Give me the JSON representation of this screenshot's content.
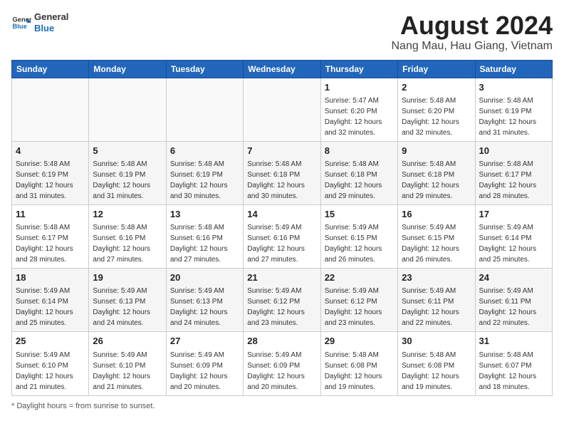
{
  "header": {
    "logo_line1": "General",
    "logo_line2": "Blue",
    "title": "August 2024",
    "subtitle": "Nang Mau, Hau Giang, Vietnam"
  },
  "days_of_week": [
    "Sunday",
    "Monday",
    "Tuesday",
    "Wednesday",
    "Thursday",
    "Friday",
    "Saturday"
  ],
  "footer": "Daylight hours",
  "weeks": [
    [
      {
        "date": "",
        "info": ""
      },
      {
        "date": "",
        "info": ""
      },
      {
        "date": "",
        "info": ""
      },
      {
        "date": "",
        "info": ""
      },
      {
        "date": "1",
        "info": "Sunrise: 5:47 AM\nSunset: 6:20 PM\nDaylight: 12 hours\nand 32 minutes."
      },
      {
        "date": "2",
        "info": "Sunrise: 5:48 AM\nSunset: 6:20 PM\nDaylight: 12 hours\nand 32 minutes."
      },
      {
        "date": "3",
        "info": "Sunrise: 5:48 AM\nSunset: 6:19 PM\nDaylight: 12 hours\nand 31 minutes."
      }
    ],
    [
      {
        "date": "4",
        "info": "Sunrise: 5:48 AM\nSunset: 6:19 PM\nDaylight: 12 hours\nand 31 minutes."
      },
      {
        "date": "5",
        "info": "Sunrise: 5:48 AM\nSunset: 6:19 PM\nDaylight: 12 hours\nand 31 minutes."
      },
      {
        "date": "6",
        "info": "Sunrise: 5:48 AM\nSunset: 6:19 PM\nDaylight: 12 hours\nand 30 minutes."
      },
      {
        "date": "7",
        "info": "Sunrise: 5:48 AM\nSunset: 6:18 PM\nDaylight: 12 hours\nand 30 minutes."
      },
      {
        "date": "8",
        "info": "Sunrise: 5:48 AM\nSunset: 6:18 PM\nDaylight: 12 hours\nand 29 minutes."
      },
      {
        "date": "9",
        "info": "Sunrise: 5:48 AM\nSunset: 6:18 PM\nDaylight: 12 hours\nand 29 minutes."
      },
      {
        "date": "10",
        "info": "Sunrise: 5:48 AM\nSunset: 6:17 PM\nDaylight: 12 hours\nand 28 minutes."
      }
    ],
    [
      {
        "date": "11",
        "info": "Sunrise: 5:48 AM\nSunset: 6:17 PM\nDaylight: 12 hours\nand 28 minutes."
      },
      {
        "date": "12",
        "info": "Sunrise: 5:48 AM\nSunset: 6:16 PM\nDaylight: 12 hours\nand 27 minutes."
      },
      {
        "date": "13",
        "info": "Sunrise: 5:48 AM\nSunset: 6:16 PM\nDaylight: 12 hours\nand 27 minutes."
      },
      {
        "date": "14",
        "info": "Sunrise: 5:49 AM\nSunset: 6:16 PM\nDaylight: 12 hours\nand 27 minutes."
      },
      {
        "date": "15",
        "info": "Sunrise: 5:49 AM\nSunset: 6:15 PM\nDaylight: 12 hours\nand 26 minutes."
      },
      {
        "date": "16",
        "info": "Sunrise: 5:49 AM\nSunset: 6:15 PM\nDaylight: 12 hours\nand 26 minutes."
      },
      {
        "date": "17",
        "info": "Sunrise: 5:49 AM\nSunset: 6:14 PM\nDaylight: 12 hours\nand 25 minutes."
      }
    ],
    [
      {
        "date": "18",
        "info": "Sunrise: 5:49 AM\nSunset: 6:14 PM\nDaylight: 12 hours\nand 25 minutes."
      },
      {
        "date": "19",
        "info": "Sunrise: 5:49 AM\nSunset: 6:13 PM\nDaylight: 12 hours\nand 24 minutes."
      },
      {
        "date": "20",
        "info": "Sunrise: 5:49 AM\nSunset: 6:13 PM\nDaylight: 12 hours\nand 24 minutes."
      },
      {
        "date": "21",
        "info": "Sunrise: 5:49 AM\nSunset: 6:12 PM\nDaylight: 12 hours\nand 23 minutes."
      },
      {
        "date": "22",
        "info": "Sunrise: 5:49 AM\nSunset: 6:12 PM\nDaylight: 12 hours\nand 23 minutes."
      },
      {
        "date": "23",
        "info": "Sunrise: 5:49 AM\nSunset: 6:11 PM\nDaylight: 12 hours\nand 22 minutes."
      },
      {
        "date": "24",
        "info": "Sunrise: 5:49 AM\nSunset: 6:11 PM\nDaylight: 12 hours\nand 22 minutes."
      }
    ],
    [
      {
        "date": "25",
        "info": "Sunrise: 5:49 AM\nSunset: 6:10 PM\nDaylight: 12 hours\nand 21 minutes."
      },
      {
        "date": "26",
        "info": "Sunrise: 5:49 AM\nSunset: 6:10 PM\nDaylight: 12 hours\nand 21 minutes."
      },
      {
        "date": "27",
        "info": "Sunrise: 5:49 AM\nSunset: 6:09 PM\nDaylight: 12 hours\nand 20 minutes."
      },
      {
        "date": "28",
        "info": "Sunrise: 5:49 AM\nSunset: 6:09 PM\nDaylight: 12 hours\nand 20 minutes."
      },
      {
        "date": "29",
        "info": "Sunrise: 5:48 AM\nSunset: 6:08 PM\nDaylight: 12 hours\nand 19 minutes."
      },
      {
        "date": "30",
        "info": "Sunrise: 5:48 AM\nSunset: 6:08 PM\nDaylight: 12 hours\nand 19 minutes."
      },
      {
        "date": "31",
        "info": "Sunrise: 5:48 AM\nSunset: 6:07 PM\nDaylight: 12 hours\nand 18 minutes."
      }
    ]
  ]
}
